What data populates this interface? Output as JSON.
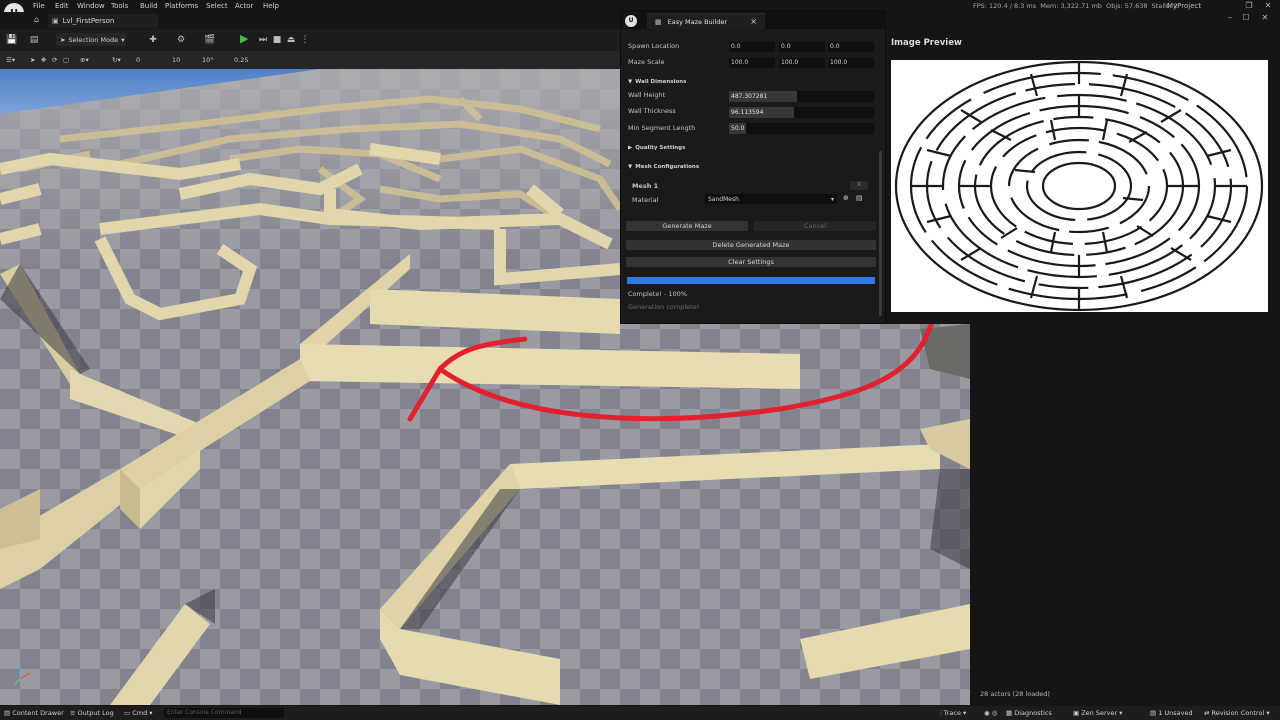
{
  "app": {
    "menu": [
      "File",
      "Edit",
      "Window",
      "Tools",
      "Build",
      "Platforms",
      "Select",
      "Actor",
      "Help"
    ],
    "stats": {
      "fps": "FPS: 120.4",
      "ms": "/ 8.3 ms",
      "mem": "Mem: 3,322.71 mb",
      "objs": "Objs: 57,638",
      "stalls": "Stalls: 2"
    },
    "project": "MyProject",
    "level_tab": "Lvl_FirstPerson"
  },
  "toolbar": {
    "selection_mode": "Selection Mode"
  },
  "viewport_toolbar": {
    "rot_snap": "0",
    "grid_snap": "10",
    "angle_snap": "10°",
    "scale_snap": "0.25"
  },
  "builder": {
    "title": "Easy Maze Builder",
    "close": "×",
    "spawn_location_label": "Spawn Location",
    "spawn_location": [
      "0.0",
      "0.0",
      "0.0"
    ],
    "maze_scale_label": "Maze Scale",
    "maze_scale": [
      "100.0",
      "100.0",
      "100.0"
    ],
    "wall_dimensions_label": "Wall Dimensions",
    "wall_height_label": "Wall Height",
    "wall_height": "487.307281",
    "wall_height_frac": 0.47,
    "wall_thickness_label": "Wall Thickness",
    "wall_thickness": "96.113594",
    "wall_thickness_frac": 0.45,
    "min_segment_label": "Min Segment Length",
    "min_segment": "50.0",
    "min_segment_frac": 0.12,
    "quality_settings_label": "Quality Settings",
    "mesh_configurations_label": "Mesh Configurations",
    "mesh_label": "Mesh 1",
    "mesh_remove": "X",
    "material_label": "Material",
    "material_value": "SandMesh",
    "generate_label": "Generate Maze",
    "cancel_label": "Cancel",
    "delete_label": "Delete Generated Maze",
    "clear_label": "Clear Settings",
    "progress": 1.0,
    "complete_text": "Complete! - 100%",
    "generation_text": "Generation complete!"
  },
  "preview": {
    "title": "Image Preview"
  },
  "outliner": {
    "actors": "28 actors (28 loaded)"
  },
  "statusbar": {
    "content_drawer": "Content Drawer",
    "output_log": "Output Log",
    "cmd": "Cmd",
    "console_placeholder": "Enter Console Command",
    "trace": "Trace",
    "diagnostics": "Diagnostics",
    "zen_server": "Zen Server",
    "unsaved": "1 Unsaved",
    "revision_control": "Revision Control"
  },
  "colors": {
    "accent_progress": "#2d7ee0",
    "annotation_red": "#e2202e",
    "wall": "#e0d4ac"
  }
}
